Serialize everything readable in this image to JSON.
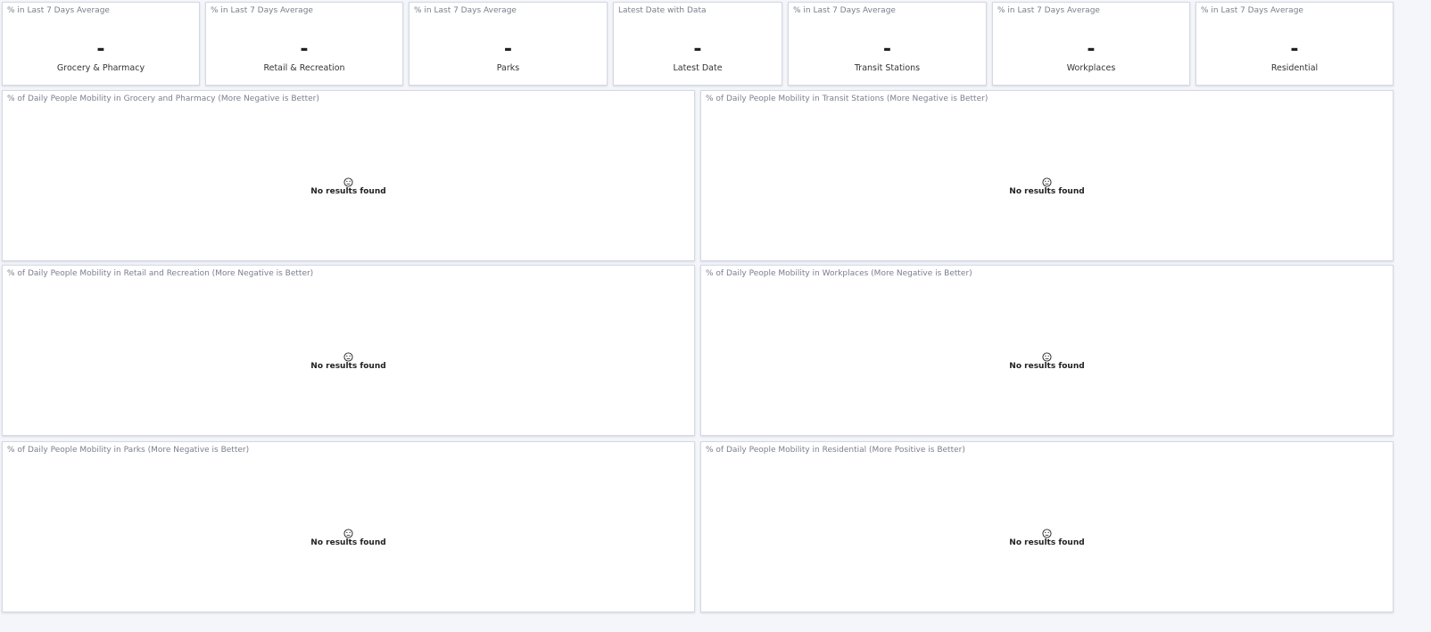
{
  "stats": [
    {
      "title": "% in Last 7 Days Average",
      "value": "-",
      "label": "Grocery & Pharmacy"
    },
    {
      "title": "% in Last 7 Days Average",
      "value": "-",
      "label": "Retail & Recreation"
    },
    {
      "title": "% in Last 7 Days Average",
      "value": "-",
      "label": "Parks"
    },
    {
      "title": "Latest Date with Data",
      "value": "-",
      "label": "Latest Date"
    },
    {
      "title": "% in Last 7 Days Average",
      "value": "-",
      "label": "Transit Stations"
    },
    {
      "title": "% in Last 7 Days Average",
      "value": "-",
      "label": "Workplaces"
    },
    {
      "title": "% in Last 7 Days Average",
      "value": "-",
      "label": "Residential"
    }
  ],
  "charts": [
    {
      "title": "% of Daily People Mobility in Grocery and Pharmacy (More Negative is Better)",
      "message": "No results found"
    },
    {
      "title": "% of Daily People Mobility in Transit Stations (More Negative is Better)",
      "message": "No results found"
    },
    {
      "title": "% of Daily People Mobility in Retail and Recreation (More Negative is Better)",
      "message": "No results found"
    },
    {
      "title": "% of Daily People Mobility in Workplaces (More Negative is Better)",
      "message": "No results found"
    },
    {
      "title": "% of Daily People Mobility in Parks (More Negative is Better)",
      "message": "No results found"
    },
    {
      "title": "% of Daily People Mobility in Residential (More Positive is Better)",
      "message": "No results found"
    }
  ],
  "icons": {
    "empty_state": "neutral-face-icon"
  }
}
